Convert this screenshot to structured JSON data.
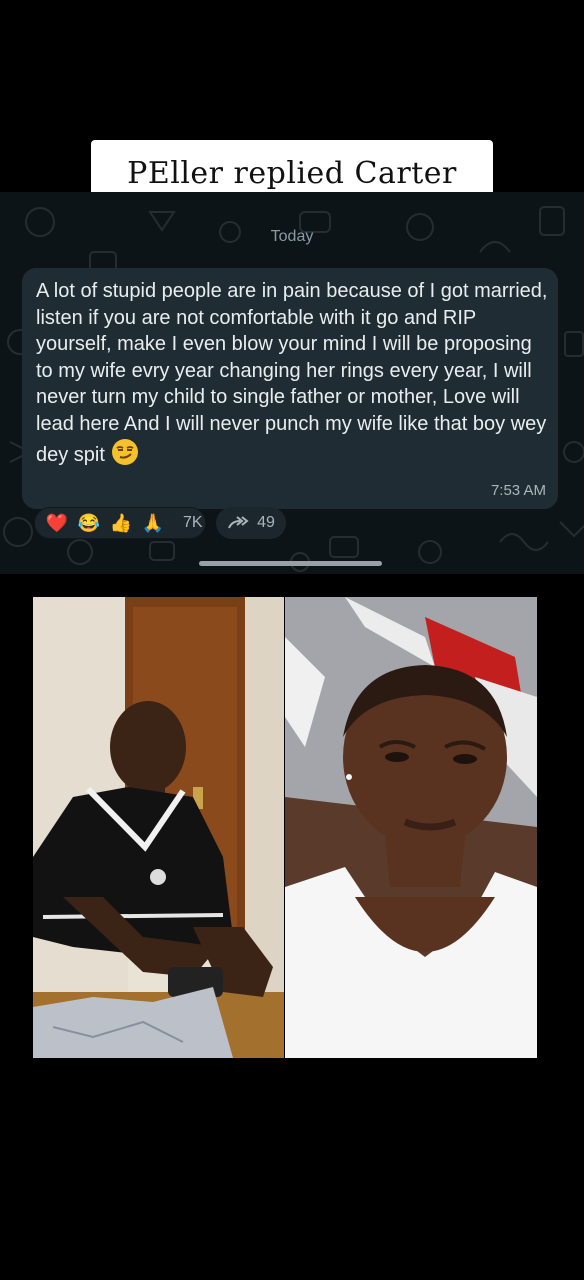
{
  "caption": "PEller replied Carter",
  "chat": {
    "date_separator": "Today",
    "message": {
      "text": "A lot of stupid people are in pain because of I got married, listen if you are not comfortable with it go and RIP yourself, make I even blow your mind I will be proposing to my wife evry year changing her rings every year, I will never turn my child to single father or mother, Love will lead here And I will never punch my wife like that boy wey dey spit",
      "trailing_emoji": "smirking-face-icon",
      "time": "7:53 AM"
    },
    "reactions": {
      "emojis": [
        "❤️",
        "😂",
        "👍",
        "🙏"
      ],
      "count": "7K"
    },
    "forwards": {
      "icon": "forward-arrows-icon",
      "count": "49"
    }
  },
  "photos": [
    {
      "subject": "man-photo"
    },
    {
      "subject": "woman-photo"
    }
  ],
  "colors": {
    "background": "#000000",
    "chat_bg": "#0d1418",
    "bubble": "#202c33",
    "text": "#e9edef",
    "meta": "#aab4ba"
  }
}
